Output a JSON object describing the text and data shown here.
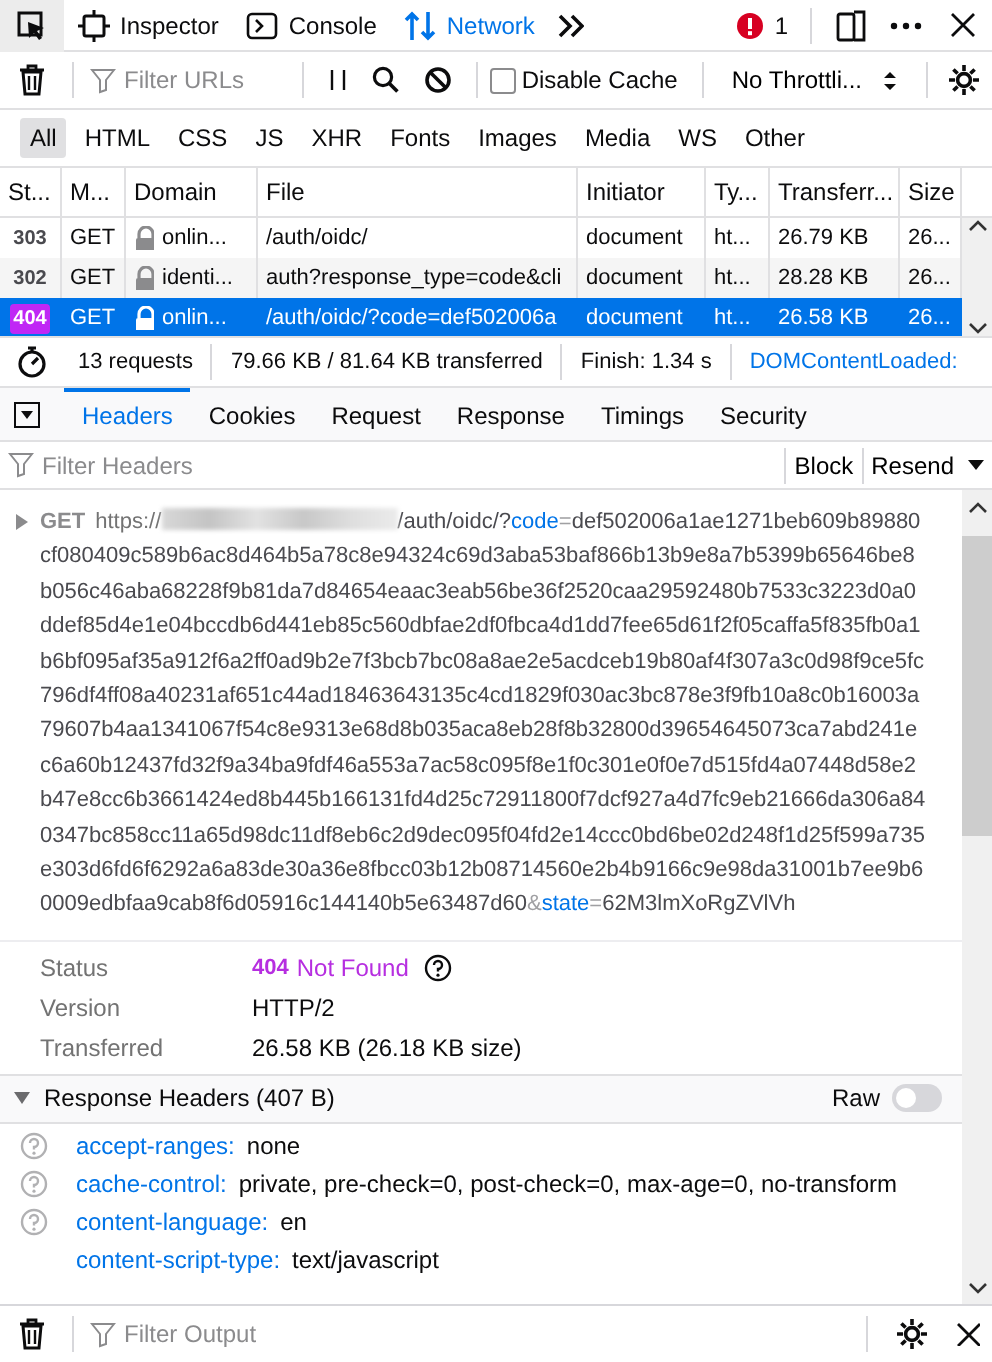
{
  "toolbox": {
    "tools": [
      {
        "kind": "picker",
        "selected": false
      },
      {
        "kind": "inspector",
        "label": "Inspector",
        "selected": false
      },
      {
        "kind": "console",
        "label": "Console",
        "selected": false
      },
      {
        "kind": "network",
        "label": "Network",
        "selected": true
      }
    ],
    "error_count": "1"
  },
  "filter_bar": {
    "placeholder": "Filter URLs",
    "disable_cache": {
      "label": "Disable Cache",
      "checked": false
    },
    "throttling": "No Throttli..."
  },
  "type_filters": [
    {
      "label": "All",
      "selected": true
    },
    {
      "label": "HTML",
      "selected": false
    },
    {
      "label": "CSS",
      "selected": false
    },
    {
      "label": "JS",
      "selected": false
    },
    {
      "label": "XHR",
      "selected": false
    },
    {
      "label": "Fonts",
      "selected": false
    },
    {
      "label": "Images",
      "selected": false
    },
    {
      "label": "Media",
      "selected": false
    },
    {
      "label": "WS",
      "selected": false
    },
    {
      "label": "Other",
      "selected": false
    }
  ],
  "table": {
    "columns": [
      "St...",
      "M...",
      "Domain",
      "File",
      "Initiator",
      "Ty...",
      "Transferr...",
      "Size"
    ],
    "rows": [
      {
        "status": "303",
        "method": "GET",
        "secure": true,
        "domain": "onlin...",
        "file": "/auth/oidc/",
        "initiator": "document",
        "type": "ht...",
        "transferred": "26.79 KB",
        "size": "26...",
        "selected": false
      },
      {
        "status": "302",
        "method": "GET",
        "secure": true,
        "domain": "identi...",
        "file": "auth?response_type=code&cli",
        "initiator": "document",
        "type": "ht...",
        "transferred": "28.28 KB",
        "size": "26...",
        "selected": false
      },
      {
        "status": "404",
        "method": "GET",
        "secure": true,
        "domain": "onlin...",
        "file": "/auth/oidc/?code=def502006a",
        "initiator": "document",
        "type": "ht...",
        "transferred": "26.58 KB",
        "size": "26...",
        "selected": true
      }
    ]
  },
  "summary": [
    "13 requests",
    "79.66 KB / 81.64 KB transferred",
    "Finish: 1.34 s",
    "DOMContentLoaded:"
  ],
  "detail_tabs": [
    {
      "label": "Headers",
      "selected": true
    },
    {
      "label": "Cookies",
      "selected": false
    },
    {
      "label": "Request",
      "selected": false
    },
    {
      "label": "Response",
      "selected": false
    },
    {
      "label": "Timings",
      "selected": false
    },
    {
      "label": "Security",
      "selected": false
    }
  ],
  "headers_filter": {
    "placeholder": "Filter Headers",
    "actions": [
      "Block",
      "Resend"
    ]
  },
  "request": {
    "expanded": false,
    "method": "GET",
    "scheme": "https://",
    "url_parts": [
      {
        "kind": "path",
        "text": "/auth/oidc/?"
      },
      {
        "kind": "key",
        "text": "code"
      },
      {
        "kind": "sep",
        "text": "="
      },
      {
        "kind": "value",
        "text": "def502006a1ae1271beb609b89880cf080409c589b6ac8d464b5a78c8e94324c69d3aba53baf866b13b9e8a7b5399b65646be8b056c46aba68228f9b81da7d84654eaac3eab56be36f2520caa29592480b7533c3223d0a0ddef85d4e1e04bccdb6d441eb85c560dbfae2df0fbca4d1dd7fee65d61f2f05caffa5f835fb0a1b6bf095af35a912f6a2ff0ad9b2e7f3bcb7bc08a8ae2e5acdceb19b80af4f307a3c0d98f9ce5fc796df4ff08a40231af651c44ad18463643135c4cd1829f030ac3bc878e3f9fb10a8c0b16003a79607b4aa1341067f54c8e9313e68d8b035aca8eb28f8b32800d39654645073ca7abd241ec6a60b12437fd32f9a34ba9fdf46a553a7ac58c095f8e1f0c301e0f0e7d515fd4a07448d58e2b47e8cc6b3661424ed8b445b166131fd4d25c72911800f7dcf927a4d7fc9eb21666da306a840347bc858cc11a65d98dc11df8eb6c2d9dec095f04fd2e14ccc0bd6be02d248f1d25f599a735e303d6fd6f6292a6a83de30a36e8fbcc03b12b08714560e2b4b9166c9e98da31001b7ee9b60009edbfaa9cab8f6d05916c144140b5e63487d60"
      },
      {
        "kind": "sep",
        "text": "&"
      },
      {
        "kind": "key",
        "text": "state"
      },
      {
        "kind": "sep",
        "text": "="
      },
      {
        "kind": "value",
        "text": "62M3lmXoRgZVlVh"
      }
    ]
  },
  "summary_fields": [
    {
      "kind": "status",
      "label": "Status",
      "code": "404",
      "value": "Not Found"
    },
    {
      "kind": "plain",
      "label": "Version",
      "value": "HTTP/2"
    },
    {
      "kind": "plain",
      "label": "Transferred",
      "value": "26.58 KB (26.18 KB size)"
    }
  ],
  "response_headers": {
    "title": "Response Headers (407 B)",
    "expanded": true,
    "raw_label": "Raw",
    "raw_on": false,
    "items": [
      {
        "name": "accept-ranges:",
        "value": "none",
        "help": true
      },
      {
        "name": "cache-control:",
        "value": "private, pre-check=0, post-check=0, max-age=0, no-transform",
        "help": true
      },
      {
        "name": "content-language:",
        "value": "en",
        "help": true
      },
      {
        "name": "content-script-type:",
        "value": "text/javascript",
        "help": false
      }
    ]
  },
  "console_bar": {
    "placeholder": "Filter Output"
  }
}
